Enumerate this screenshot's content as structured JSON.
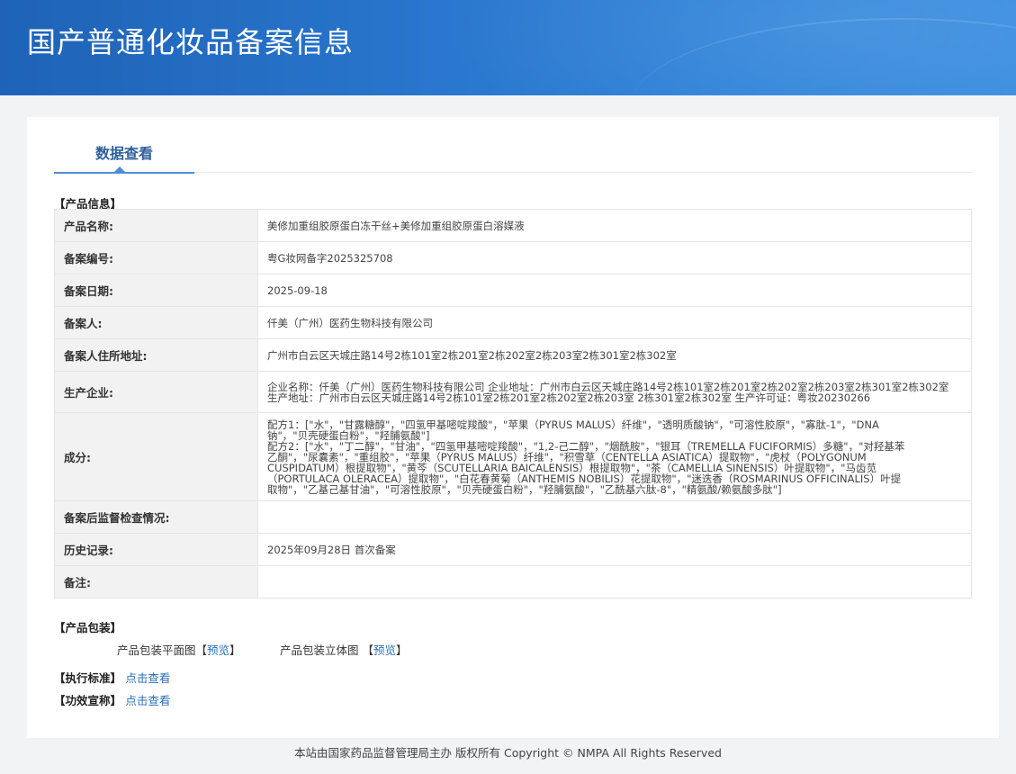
{
  "page_title": "国产普通化妆品备案信息",
  "tab_label": "数据查看",
  "product_section_title": "【产品信息】",
  "rows": [
    {
      "label": "产品名称:",
      "value": "美修加重组胶原蛋白冻干丝+美修加重组胶原蛋白溶媒液"
    },
    {
      "label": "备案编号:",
      "value": "粤G妆网备字2025325708"
    },
    {
      "label": "备案日期:",
      "value": "2025-09-18"
    },
    {
      "label": "备案人:",
      "value": "仟美（广州）医药生物科技有限公司"
    },
    {
      "label": "备案人住所地址:",
      "value": "广州市白云区天城庄路14号2栋101室2栋201室2栋202室2栋203室2栋301室2栋302室"
    },
    {
      "label": "生产企业:",
      "value": "企业名称：仟美（广州）医药生物科技有限公司 企业地址：广州市白云区天城庄路14号2栋101室2栋201室2栋202室2栋203室2栋301室2栋302室 生产地址：广州市白云区天城庄路14号2栋101室2栋201室2栋202室2栋203室 2栋301室2栋302室 生产许可证：粤妆20230266"
    },
    {
      "label": "成分:",
      "value_lines": [
        "配方1：[\"水\"，\"甘露糖醇\"，\"四氢甲基嘧啶羧酸\"，\"苹果（PYRUS MALUS）纤维\"，\"透明质酸钠\"，\"可溶性胶原\"，\"寡肽-1\"，\"DNA",
        "钠\"，\"贝壳硬蛋白粉\"，\"羟脯氨酸\"]",
        "配方2：[\"水\"，\"丁二醇\"，\"甘油\"，\"四氢甲基嘧啶羧酸\"，\"1,2-己二醇\"，\"烟酰胺\"，\"银耳（TREMELLA FUCIFORMIS）多糖\"，\"对羟基苯",
        "乙酮\"，\"尿囊素\"，\"重组胶\"，\"苹果（PYRUS MALUS）纤维\"，\"积雪草（CENTELLA ASIATICA）提取物\"，\"虎杖（POLYGONUM",
        "CUSPIDATUM）根提取物\"，\"黄芩（SCUTELLARIA BAICALENSIS）根提取物\"，\"茶（CAMELLIA SINENSIS）叶提取物\"，\"马齿苋",
        "（PORTULACA OLERACEA）提取物\"，\"白花春黄菊（ANTHEMIS NOBILIS）花提取物\"，\"迷迭香（ROSMARINUS OFFICINALIS）叶提",
        "取物\"，\"乙基己基甘油\"，\"可溶性胶原\"，\"贝壳硬蛋白粉\"，\"羟脯氨酸\"，\"乙酰基六肽-8\"，\"精氨酸/赖氨酸多肽\"]"
      ]
    },
    {
      "label": "备案后监督检查情况:",
      "value": ""
    },
    {
      "label": "历史记录:",
      "value": "2025年09月28日 首次备案"
    },
    {
      "label": "备注:",
      "value": ""
    }
  ],
  "packaging": {
    "title": "【产品包装】",
    "flat_label": "产品包装平面图",
    "solid_label": "产品包装立体图",
    "bracket_open": "【",
    "bracket_close": "】",
    "preview_label": "预览"
  },
  "standard": {
    "title": "【执行标准】",
    "link": "点击查看"
  },
  "efficacy": {
    "title": "【功效宣称】",
    "link": "点击查看"
  },
  "footer": "本站由国家药品监督管理局主办 版权所有 Copyright © NMPA All Rights Reserved"
}
